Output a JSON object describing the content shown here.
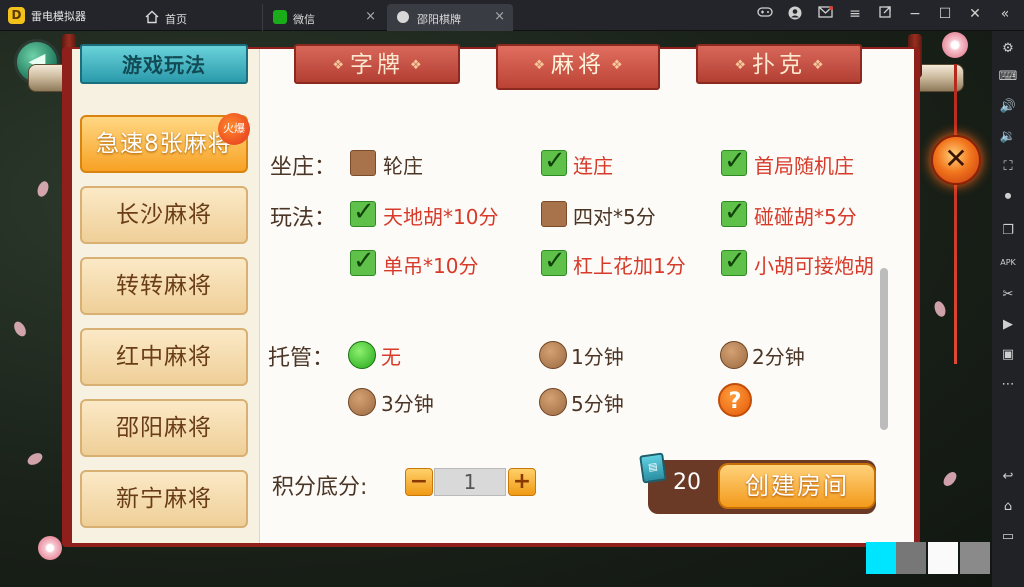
{
  "emulator": {
    "app_title": "雷电模拟器",
    "tabs": [
      {
        "label": "首页",
        "icon": "home-icon"
      },
      {
        "label": "微信",
        "icon": "wechat-icon",
        "close": "×"
      },
      {
        "label": "邵阳棋牌",
        "icon": "app-icon",
        "close": "×"
      }
    ],
    "window_icons": [
      "gamepad-icon",
      "user-icon",
      "mail-icon",
      "menu-icon",
      "popout-icon",
      "minimize-icon",
      "maximize-icon",
      "close-icon",
      "collapse-icon"
    ],
    "sidebar_icons": [
      "settings-icon",
      "keyboard-icon",
      "volume-up-icon",
      "volume-down-icon",
      "fullscreen-icon",
      "record-icon",
      "multi-window-icon",
      "apk-icon",
      "scissors-icon",
      "video-icon",
      "screenshot-icon",
      "more-icon",
      "back-icon",
      "home-icon",
      "recent-apps-icon"
    ]
  },
  "game": {
    "top_tabs": {
      "rules": "游戏玩法",
      "zipai": "字牌",
      "mahjong": "麻将",
      "poker": "扑克"
    },
    "game_list": [
      {
        "label": "急速8张麻将",
        "active": true,
        "badge": "火爆"
      },
      {
        "label": "长沙麻将",
        "active": false
      },
      {
        "label": "转转麻将",
        "active": false
      },
      {
        "label": "红中麻将",
        "active": false
      },
      {
        "label": "邵阳麻将",
        "active": false
      },
      {
        "label": "新宁麻将",
        "active": false
      }
    ],
    "options": {
      "zhuang": {
        "label": "坐庄：",
        "items": [
          {
            "label": "轮庄",
            "checked": false
          },
          {
            "label": "连庄",
            "checked": true
          },
          {
            "label": "首局随机庄",
            "checked": true
          }
        ]
      },
      "wanfa": {
        "label": "玩法：",
        "items": [
          {
            "label": "天地胡*10分",
            "checked": true
          },
          {
            "label": "四对*5分",
            "checked": false
          },
          {
            "label": "碰碰胡*5分",
            "checked": true
          },
          {
            "label": "单吊*10分",
            "checked": true
          },
          {
            "label": "杠上花加1分",
            "checked": true
          },
          {
            "label": "小胡可接炮胡",
            "checked": true
          }
        ]
      },
      "tuoguan": {
        "label": "托管：",
        "items": [
          {
            "label": "无",
            "selected": true
          },
          {
            "label": "1分钟",
            "selected": false
          },
          {
            "label": "2分钟",
            "selected": false
          },
          {
            "label": "3分钟",
            "selected": false
          },
          {
            "label": "5分钟",
            "selected": false
          }
        ],
        "help": "?"
      },
      "score": {
        "label": "积分底分:",
        "value": "1",
        "minus": "−",
        "plus": "+"
      }
    },
    "create": {
      "cost": "20",
      "label": "创建房间"
    },
    "close": "✕"
  },
  "colors": {
    "accent_red": "#d63a2a",
    "check_green": "#5fc14a",
    "button_orange": "#f39a1c",
    "tab_teal": "#2a9aab"
  }
}
